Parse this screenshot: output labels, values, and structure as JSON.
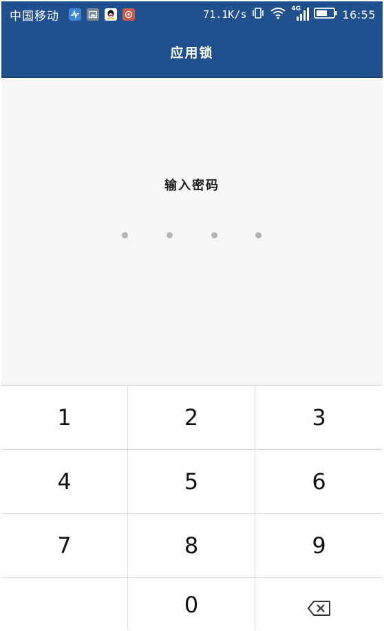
{
  "status_bar": {
    "carrier": "中国移动",
    "network_speed": "71.1K/s",
    "network_type": "4G",
    "time": "16:55",
    "notification_icons": [
      "health-app-icon",
      "gallery-icon",
      "qq-icon",
      "app-badge-icon"
    ]
  },
  "header": {
    "title": "应用锁"
  },
  "pin": {
    "prompt": "输入密码",
    "entered_digits": 0,
    "length": 4
  },
  "keypad": {
    "keys": [
      "1",
      "2",
      "3",
      "4",
      "5",
      "6",
      "7",
      "8",
      "9",
      "",
      "0",
      "delete"
    ]
  },
  "colors": {
    "header_bg": "#21508f",
    "body_bg": "#f6f6f6",
    "dot": "#b3b3b3"
  }
}
